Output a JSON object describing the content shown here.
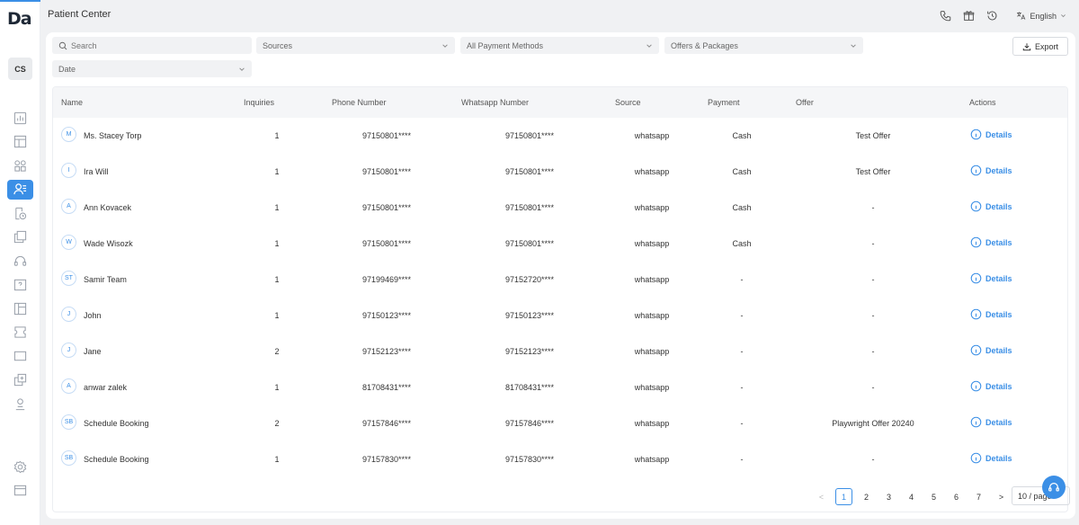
{
  "app": {
    "logo": "Da",
    "user_initials": "CS",
    "title": "Patient Center",
    "language": "English"
  },
  "filters": {
    "search_placeholder": "Search",
    "sources": "Sources",
    "payment": "All Payment Methods",
    "offers": "Offers & Packages",
    "date": "Date",
    "export_label": "Export"
  },
  "table": {
    "columns": [
      "Name",
      "Inquiries",
      "Phone Number",
      "Whatsapp Number",
      "Source",
      "Payment",
      "Offer",
      "Actions"
    ],
    "details_label": "Details",
    "rows": [
      {
        "initials": "M",
        "name": "Ms. Stacey Torp",
        "inquiries": "1",
        "phone": "97150801****",
        "whatsapp": "97150801****",
        "source": "whatsapp",
        "payment": "Cash",
        "offer": "Test Offer"
      },
      {
        "initials": "I",
        "name": "Ira Will",
        "inquiries": "1",
        "phone": "97150801****",
        "whatsapp": "97150801****",
        "source": "whatsapp",
        "payment": "Cash",
        "offer": "Test Offer"
      },
      {
        "initials": "A",
        "name": "Ann Kovacek",
        "inquiries": "1",
        "phone": "97150801****",
        "whatsapp": "97150801****",
        "source": "whatsapp",
        "payment": "Cash",
        "offer": "-"
      },
      {
        "initials": "W",
        "name": "Wade Wisozk",
        "inquiries": "1",
        "phone": "97150801****",
        "whatsapp": "97150801****",
        "source": "whatsapp",
        "payment": "Cash",
        "offer": "-"
      },
      {
        "initials": "ST",
        "name": "Samir Team",
        "inquiries": "1",
        "phone": "97199469****",
        "whatsapp": "97152720****",
        "source": "whatsapp",
        "payment": "-",
        "offer": "-"
      },
      {
        "initials": "J",
        "name": "John",
        "inquiries": "1",
        "phone": "97150123****",
        "whatsapp": "97150123****",
        "source": "whatsapp",
        "payment": "-",
        "offer": "-"
      },
      {
        "initials": "J",
        "name": "Jane",
        "inquiries": "2",
        "phone": "97152123****",
        "whatsapp": "97152123****",
        "source": "whatsapp",
        "payment": "-",
        "offer": "-"
      },
      {
        "initials": "A",
        "name": "anwar zalek",
        "inquiries": "1",
        "phone": "81708431****",
        "whatsapp": "81708431****",
        "source": "whatsapp",
        "payment": "-",
        "offer": "-"
      },
      {
        "initials": "SB",
        "name": "Schedule Booking",
        "inquiries": "2",
        "phone": "97157846****",
        "whatsapp": "97157846****",
        "source": "whatsapp",
        "payment": "-",
        "offer": "Playwright Offer 20240"
      },
      {
        "initials": "SB",
        "name": "Schedule Booking",
        "inquiries": "1",
        "phone": "97157830****",
        "whatsapp": "97157830****",
        "source": "whatsapp",
        "payment": "-",
        "offer": "-"
      }
    ]
  },
  "pagination": {
    "pages": [
      "1",
      "2",
      "3",
      "4",
      "5",
      "6",
      "7"
    ],
    "current": "1",
    "prev": "<",
    "next": ">",
    "page_size": "10 / page"
  },
  "colors": {
    "accent": "#3b8fe6"
  }
}
